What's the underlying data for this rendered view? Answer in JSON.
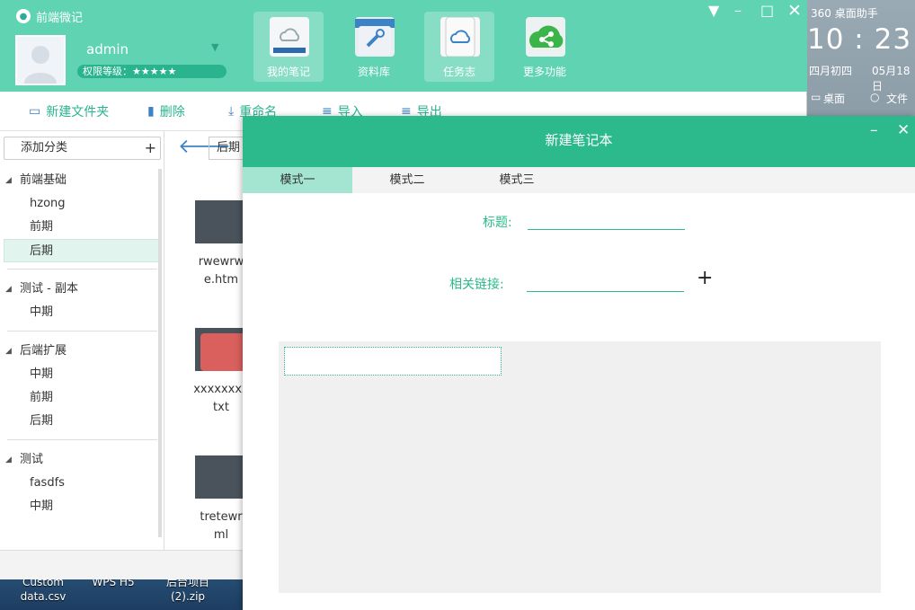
{
  "app": {
    "title": "前端微记",
    "user": {
      "name": "admin",
      "level": "权限等级：★★★★★"
    },
    "nav": [
      {
        "label": "我的笔记",
        "icon": "notebook-cloud-icon"
      },
      {
        "label": "资料库",
        "icon": "toolbox-icon"
      },
      {
        "label": "任务志",
        "icon": "tablet-cloud-icon"
      },
      {
        "label": "更多功能",
        "icon": "share-cloud-icon"
      }
    ],
    "toolbar": {
      "new_folder": "新建文件夹",
      "delete": "删除",
      "rename": "重命名",
      "import": "导入",
      "export": "导出"
    },
    "sidebar": {
      "add_category": "添加分类",
      "add_symbol": "+",
      "groups": [
        {
          "label": "前端基础",
          "items": [
            "hzong",
            "前期",
            "后期"
          ]
        },
        {
          "label": "测试 - 副本",
          "items": [
            "中期"
          ]
        },
        {
          "label": "后端扩展",
          "items": [
            "中期",
            "前期",
            "后期"
          ]
        },
        {
          "label": "测试",
          "items": [
            "fasdfs",
            "中期"
          ]
        }
      ]
    },
    "path": "后期",
    "files": [
      {
        "name": "rwewrw\ne.htm"
      },
      {
        "name": "xxxxxxxx\ntxt"
      },
      {
        "name": "tretewr\nml"
      }
    ]
  },
  "desktop": {
    "files": [
      "Custom\ndata.csv",
      "WPS H5",
      "后台项目\n(2).zip"
    ],
    "widget": {
      "title": "360 桌面助手",
      "time": "10 : 23",
      "lunar": "四月初四",
      "date": "05月18日",
      "desk": "桌面",
      "file": "文件"
    }
  },
  "dialog": {
    "title": "新建笔记本",
    "tabs": [
      "模式一",
      "模式二",
      "模式三"
    ],
    "title_label": "标题:",
    "link_label": "相关链接:",
    "add_link": "+",
    "title_value": "",
    "link_value": ""
  },
  "colors": {
    "primary": "#5fd3b2",
    "accent": "#2cb98c",
    "blue": "#3c82c6"
  }
}
